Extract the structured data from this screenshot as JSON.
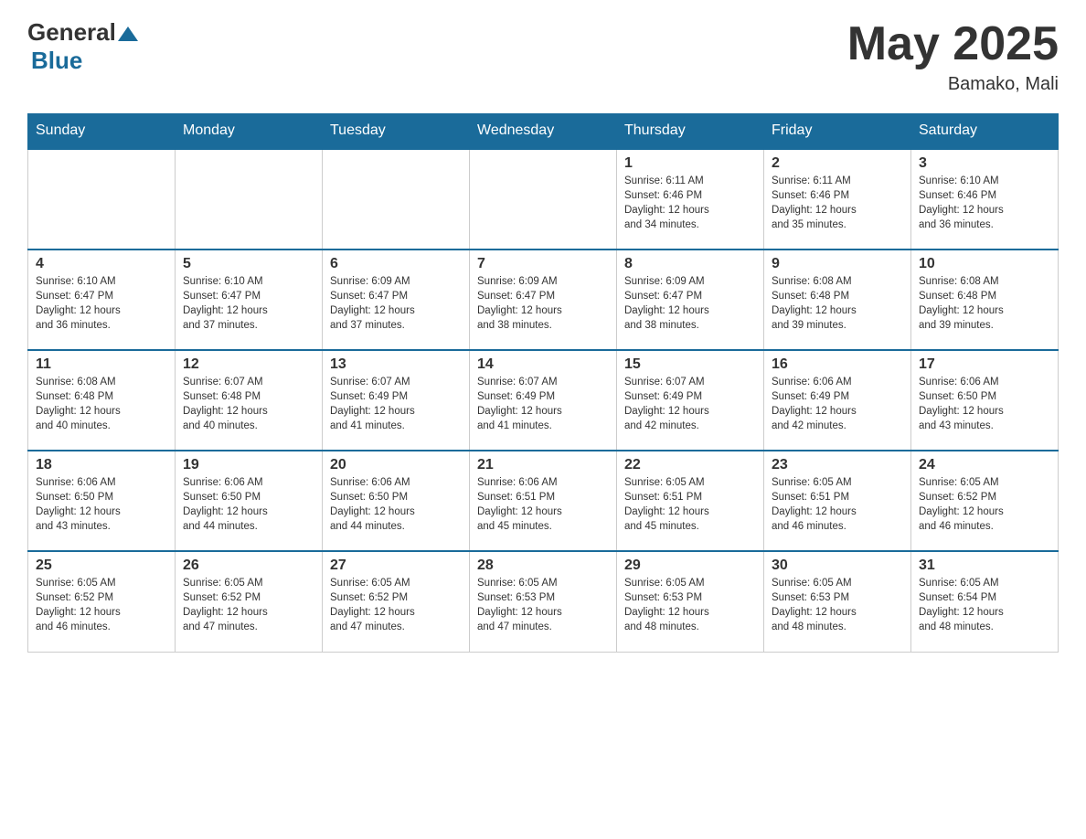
{
  "header": {
    "logo_general": "General",
    "logo_blue": "Blue",
    "month_title": "May 2025",
    "location": "Bamako, Mali"
  },
  "days_of_week": [
    "Sunday",
    "Monday",
    "Tuesday",
    "Wednesday",
    "Thursday",
    "Friday",
    "Saturday"
  ],
  "weeks": [
    [
      {
        "day": "",
        "info": ""
      },
      {
        "day": "",
        "info": ""
      },
      {
        "day": "",
        "info": ""
      },
      {
        "day": "",
        "info": ""
      },
      {
        "day": "1",
        "info": "Sunrise: 6:11 AM\nSunset: 6:46 PM\nDaylight: 12 hours\nand 34 minutes."
      },
      {
        "day": "2",
        "info": "Sunrise: 6:11 AM\nSunset: 6:46 PM\nDaylight: 12 hours\nand 35 minutes."
      },
      {
        "day": "3",
        "info": "Sunrise: 6:10 AM\nSunset: 6:46 PM\nDaylight: 12 hours\nand 36 minutes."
      }
    ],
    [
      {
        "day": "4",
        "info": "Sunrise: 6:10 AM\nSunset: 6:47 PM\nDaylight: 12 hours\nand 36 minutes."
      },
      {
        "day": "5",
        "info": "Sunrise: 6:10 AM\nSunset: 6:47 PM\nDaylight: 12 hours\nand 37 minutes."
      },
      {
        "day": "6",
        "info": "Sunrise: 6:09 AM\nSunset: 6:47 PM\nDaylight: 12 hours\nand 37 minutes."
      },
      {
        "day": "7",
        "info": "Sunrise: 6:09 AM\nSunset: 6:47 PM\nDaylight: 12 hours\nand 38 minutes."
      },
      {
        "day": "8",
        "info": "Sunrise: 6:09 AM\nSunset: 6:47 PM\nDaylight: 12 hours\nand 38 minutes."
      },
      {
        "day": "9",
        "info": "Sunrise: 6:08 AM\nSunset: 6:48 PM\nDaylight: 12 hours\nand 39 minutes."
      },
      {
        "day": "10",
        "info": "Sunrise: 6:08 AM\nSunset: 6:48 PM\nDaylight: 12 hours\nand 39 minutes."
      }
    ],
    [
      {
        "day": "11",
        "info": "Sunrise: 6:08 AM\nSunset: 6:48 PM\nDaylight: 12 hours\nand 40 minutes."
      },
      {
        "day": "12",
        "info": "Sunrise: 6:07 AM\nSunset: 6:48 PM\nDaylight: 12 hours\nand 40 minutes."
      },
      {
        "day": "13",
        "info": "Sunrise: 6:07 AM\nSunset: 6:49 PM\nDaylight: 12 hours\nand 41 minutes."
      },
      {
        "day": "14",
        "info": "Sunrise: 6:07 AM\nSunset: 6:49 PM\nDaylight: 12 hours\nand 41 minutes."
      },
      {
        "day": "15",
        "info": "Sunrise: 6:07 AM\nSunset: 6:49 PM\nDaylight: 12 hours\nand 42 minutes."
      },
      {
        "day": "16",
        "info": "Sunrise: 6:06 AM\nSunset: 6:49 PM\nDaylight: 12 hours\nand 42 minutes."
      },
      {
        "day": "17",
        "info": "Sunrise: 6:06 AM\nSunset: 6:50 PM\nDaylight: 12 hours\nand 43 minutes."
      }
    ],
    [
      {
        "day": "18",
        "info": "Sunrise: 6:06 AM\nSunset: 6:50 PM\nDaylight: 12 hours\nand 43 minutes."
      },
      {
        "day": "19",
        "info": "Sunrise: 6:06 AM\nSunset: 6:50 PM\nDaylight: 12 hours\nand 44 minutes."
      },
      {
        "day": "20",
        "info": "Sunrise: 6:06 AM\nSunset: 6:50 PM\nDaylight: 12 hours\nand 44 minutes."
      },
      {
        "day": "21",
        "info": "Sunrise: 6:06 AM\nSunset: 6:51 PM\nDaylight: 12 hours\nand 45 minutes."
      },
      {
        "day": "22",
        "info": "Sunrise: 6:05 AM\nSunset: 6:51 PM\nDaylight: 12 hours\nand 45 minutes."
      },
      {
        "day": "23",
        "info": "Sunrise: 6:05 AM\nSunset: 6:51 PM\nDaylight: 12 hours\nand 46 minutes."
      },
      {
        "day": "24",
        "info": "Sunrise: 6:05 AM\nSunset: 6:52 PM\nDaylight: 12 hours\nand 46 minutes."
      }
    ],
    [
      {
        "day": "25",
        "info": "Sunrise: 6:05 AM\nSunset: 6:52 PM\nDaylight: 12 hours\nand 46 minutes."
      },
      {
        "day": "26",
        "info": "Sunrise: 6:05 AM\nSunset: 6:52 PM\nDaylight: 12 hours\nand 47 minutes."
      },
      {
        "day": "27",
        "info": "Sunrise: 6:05 AM\nSunset: 6:52 PM\nDaylight: 12 hours\nand 47 minutes."
      },
      {
        "day": "28",
        "info": "Sunrise: 6:05 AM\nSunset: 6:53 PM\nDaylight: 12 hours\nand 47 minutes."
      },
      {
        "day": "29",
        "info": "Sunrise: 6:05 AM\nSunset: 6:53 PM\nDaylight: 12 hours\nand 48 minutes."
      },
      {
        "day": "30",
        "info": "Sunrise: 6:05 AM\nSunset: 6:53 PM\nDaylight: 12 hours\nand 48 minutes."
      },
      {
        "day": "31",
        "info": "Sunrise: 6:05 AM\nSunset: 6:54 PM\nDaylight: 12 hours\nand 48 minutes."
      }
    ]
  ]
}
